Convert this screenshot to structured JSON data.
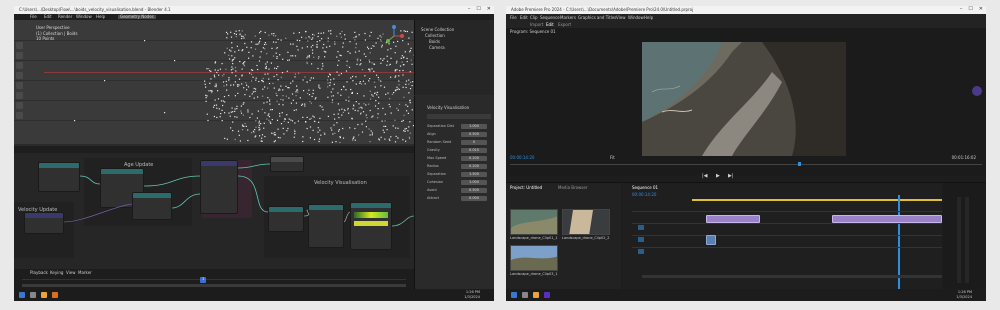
{
  "blender": {
    "title": "C:\\Users\\...\\Desktop\\Flow\\...\\boids_velocity_visualisation.blend - Blender 4.1",
    "menu": [
      "File",
      "Edit",
      "Render",
      "Window",
      "Help",
      "Geometry Nodes"
    ],
    "viewport_info": [
      "User Perspective",
      "(1) Collection | Boids",
      "10 Points"
    ],
    "outliner_items": [
      "Scene Collection",
      "Collection",
      "Boids",
      "Camera"
    ],
    "props_title": "Velocity Visualisation",
    "props_rows": [
      {
        "label": "Separation Dist",
        "value": "1.000"
      },
      {
        "label": "Align",
        "value": "0.500"
      },
      {
        "label": "Random Seed",
        "value": "0"
      },
      {
        "label": "Gravity",
        "value": "0.010"
      },
      {
        "label": "Max Speed",
        "value": "0.200"
      },
      {
        "label": "Radius",
        "value": "0.200"
      },
      {
        "label": "Separation",
        "value": "1.500"
      },
      {
        "label": "Cohesion",
        "value": "1.000"
      },
      {
        "label": "Avoid",
        "value": "0.500"
      },
      {
        "label": "Attract",
        "value": "0.000"
      }
    ],
    "frames": [
      "Age Update",
      "Velocity Visualisation",
      "Velocity Update"
    ],
    "timeline_labels": [
      "Playback",
      "Keying",
      "View",
      "Marker"
    ],
    "frame_current": "1"
  },
  "premiere": {
    "title": "Adobe Premiere Pro 2024 - C:\\Users\\...\\Documents\\Adobe\\Premiere Pro\\24.0\\Untitled.prproj",
    "menu": [
      "File",
      "Edit",
      "Clip",
      "Sequence",
      "Markers",
      "Graphics and Titles",
      "View",
      "Window",
      "Help"
    ],
    "workspace_tabs": [
      "Import",
      "Edit",
      "Export"
    ],
    "program_label": "Program: Sequence 01",
    "timecode_left": "00:00:14:20",
    "timecode_right": "00:01:16:02",
    "fit_label": "Fit",
    "project_tab": "Project: Untitled",
    "media_browser": "Media Browser",
    "clips": [
      {
        "name": "Landscape_drone_Clip01_1",
        "duration": "12:24"
      },
      {
        "name": "Landscape_drone_Clip02_2",
        "duration": "9:04"
      },
      {
        "name": "Landscape_drone_Clip03_1",
        "duration": "10:17"
      }
    ],
    "sequence_tab": "Sequence 01",
    "timeline_timecode": "00:00:14:20",
    "tracks": [
      "V3",
      "V2",
      "V1",
      "A1",
      "A2",
      "A3"
    ]
  },
  "taskbar": {
    "time": "1:26 PM",
    "date": "1/3/2024"
  }
}
